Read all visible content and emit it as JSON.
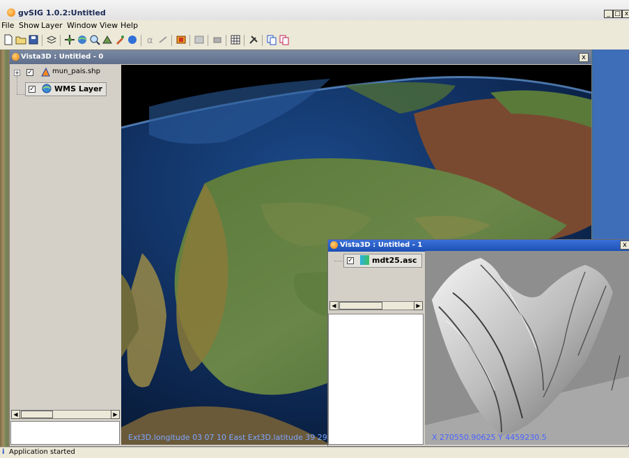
{
  "app": {
    "title": "gvSIG 1.0.2:Untitled",
    "window_buttons": [
      "_",
      "□",
      "x"
    ]
  },
  "menu": [
    "File",
    "Show",
    "Layer",
    "Window",
    "View",
    "Help"
  ],
  "status": {
    "text": "Application started",
    "icon": "info-icon"
  },
  "frame1": {
    "title": "Vista3D : Untitled - 0",
    "close": "x",
    "layers": [
      {
        "name": "mun_pais.shp",
        "checked": "✓",
        "icon": "shapefile-icon",
        "expand": "+"
      },
      {
        "name": "WMS Layer",
        "checked": "✓",
        "icon": "wms-icon"
      }
    ],
    "scroll_left": "◀",
    "scroll_right": "▶",
    "readout": "Ext3D.longitude 03 07 10 East Ext3D.latitude 39 29"
  },
  "frame2": {
    "title": "Vista3D : Untitled - 1",
    "close": "x",
    "layers": [
      {
        "name": "mdt25.asc",
        "checked": "✓",
        "icon": "raster-icon"
      }
    ],
    "scroll_left": "◀",
    "scroll_right": "▶",
    "readout": "X  270550.90625 Y  4459230.5"
  },
  "colors": {
    "title_inactive": "#6a7a96",
    "title_active": "#2a5fcc",
    "readout_globe": "#7fa6ff",
    "readout_terrain": "#4a63ff"
  }
}
